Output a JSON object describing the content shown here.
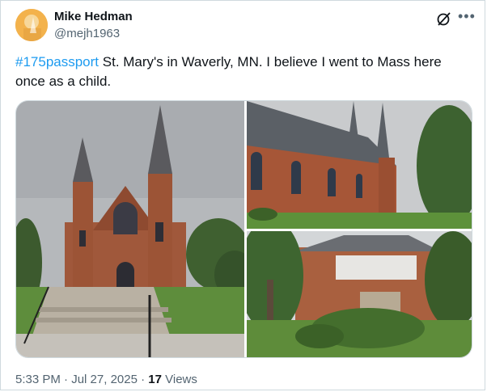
{
  "author": {
    "display_name": "Mike Hedman",
    "handle": "@mejh1963"
  },
  "post": {
    "hashtag": "#175passport",
    "body": " St. Mary's in Waverly, MN.  I believe I went to Mass here once as a child."
  },
  "media": [
    {
      "name": "church-front-photo"
    },
    {
      "name": "church-side-photo"
    },
    {
      "name": "church-sign-garden-photo"
    }
  ],
  "footer": {
    "time": "5:33 PM",
    "separator1": " · ",
    "date": "Jul 27, 2025",
    "separator2": " · ",
    "views_count": "17",
    "views_label": " Views"
  },
  "icons": {
    "grok": "grok-icon",
    "more": "more-icon"
  },
  "colors": {
    "link": "#1d9bf0",
    "secondary_text": "#536471",
    "border": "#cfd9de"
  }
}
